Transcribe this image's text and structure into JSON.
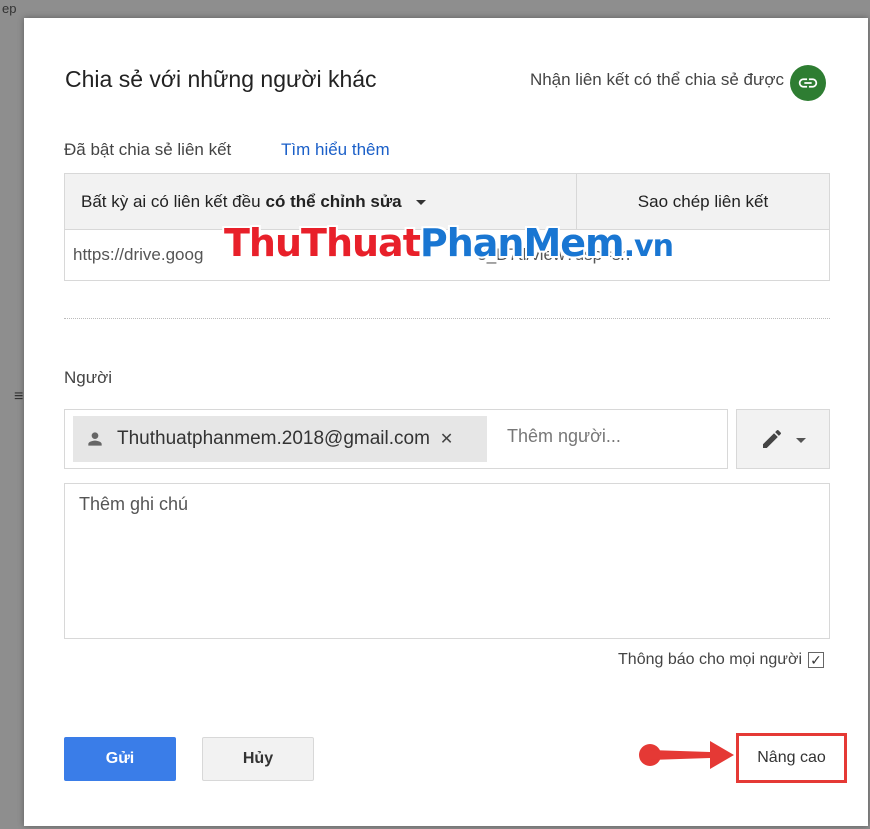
{
  "background": {
    "fragment_top": "ep",
    "fragment_left": "≡"
  },
  "dialog": {
    "title": "Chia sẻ với những người khác",
    "get_link_text": "Nhận liên kết có thể chia sẻ được",
    "link_sharing_status": "Đã bật chia sẻ liên kết",
    "learn_more": "Tìm hiểu thêm",
    "permission": {
      "prefix": "Bất kỳ ai có liên kết đều",
      "level": "có thể chỉnh sửa"
    },
    "copy_link_label": "Sao chép liên kết",
    "share_url": "https://drive.goog                                                          5_D7tl/view?usp=sh",
    "watermark": {
      "part1": "ThuThuat",
      "part2": "PhanMem",
      "part3": ".vn"
    },
    "people_label": "Người",
    "recipient_email": "Thuthuatphanmem.2018@gmail.com",
    "add_people_placeholder": "Thêm người...",
    "note_placeholder": "Thêm ghi chú",
    "notify_label": "Thông báo cho mọi người",
    "notify_checked": true,
    "send_label": "Gửi",
    "cancel_label": "Hủy",
    "advanced_label": "Nâng cao"
  },
  "colors": {
    "primary_button": "#3a7de8",
    "link_blue": "#1a5fc8",
    "link_icon_green": "#2e7d32",
    "highlight_red": "#e53935"
  },
  "icons": [
    "link-icon",
    "person-icon",
    "remove-icon",
    "pencil-icon",
    "chevron-down-icon",
    "checkbox-icon",
    "arrow-pointer-icon"
  ]
}
